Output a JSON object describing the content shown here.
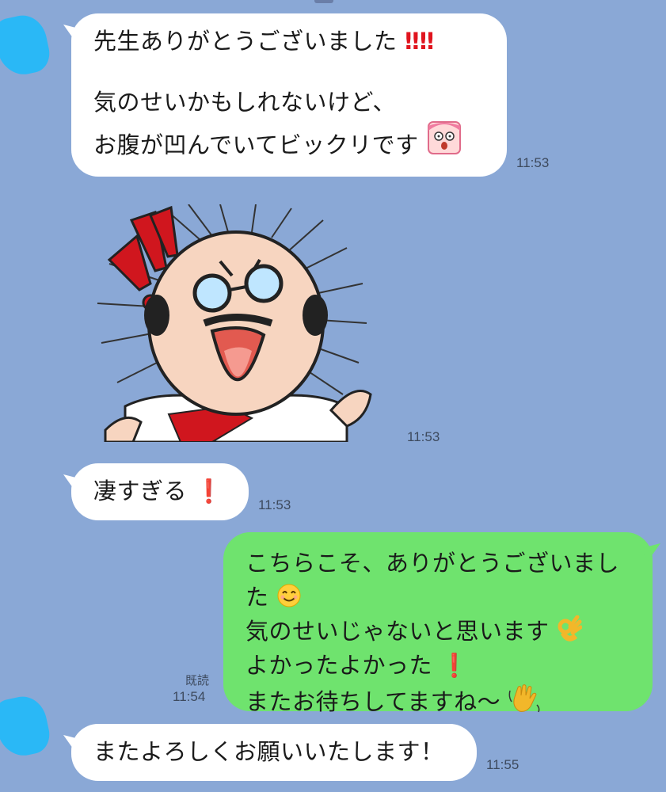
{
  "messages": [
    {
      "side": "received",
      "lines": [
        "先生ありがとうございました",
        "",
        "気のせいかもしれないけど、",
        "お腹が凹んでいてビックリです"
      ],
      "emoji": [
        "double-exclamation-emoji",
        "double-exclamation-emoji",
        "surprised-face-sticker-emoji"
      ],
      "time": "11:53"
    },
    {
      "side": "received",
      "type": "sticker",
      "sticker": "shocked-bald-man-sticker",
      "time": "11:53"
    },
    {
      "side": "received",
      "lines": [
        "凄すぎる"
      ],
      "emoji": [
        "exclamation-emoji"
      ],
      "time": "11:53"
    },
    {
      "side": "sent",
      "lines": [
        "こちらこそ、ありがとうございまし",
        "た",
        "気のせいじゃないと思います",
        "よかったよかった",
        "またお待ちしてますね〜"
      ],
      "emoji": [
        "smiling-face-emoji",
        "ok-hand-emoji",
        "exclamation-emoji",
        "waving-hand-emoji"
      ],
      "read_label": "既読",
      "time": "11:54"
    },
    {
      "side": "received",
      "lines": [
        "またよろしくお願いいたします！"
      ],
      "time": "11:55"
    }
  ],
  "colors": {
    "background": "#8aa8d6",
    "received_bubble": "#ffffff",
    "sent_bubble": "#6fe36e",
    "avatar": "#2ab8f6",
    "exclamation": "#e0141e"
  }
}
